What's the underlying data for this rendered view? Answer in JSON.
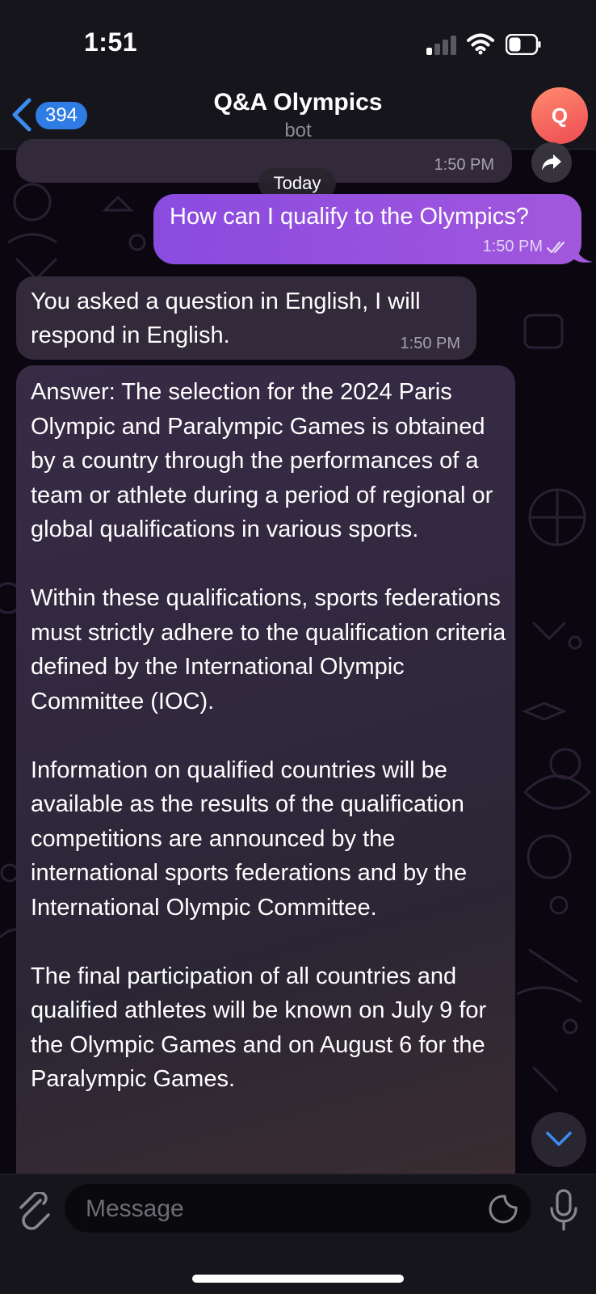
{
  "status_bar": {
    "time": "1:51"
  },
  "header": {
    "back_count": "394",
    "title": "Q&A Olympics",
    "subtitle": "bot",
    "avatar_letter": "Q",
    "avatar_color": "#f25a57"
  },
  "messages": {
    "previous_time": "1:50 PM",
    "day_separator": "Today",
    "outgoing": {
      "text": "How can I qualify to the Olympics?",
      "time": "1:50 PM",
      "status": "read"
    },
    "incoming_1": {
      "text": "You asked a question in English, I will respond in English.",
      "time": "1:50 PM"
    },
    "incoming_2": {
      "text": "Answer: The selection for the 2024 Paris Olympic and Paralympic Games is obtained by a country through the performances of a team or athlete during a period of regional or global qualifications in various sports.\n\nWithin these qualifications, sports federations must strictly adhere to the qualification criteria defined by the International Olympic Committee (IOC).\n\nInformation on qualified countries will be available as the results of the qualification competitions are announced by the international sports federations and by the International Olympic Committee.\n\nThe final participation of all countries and qualified athletes will be known on July 9 for the Olympic Games and on August 6 for the Paralympic Games."
    }
  },
  "composer": {
    "placeholder": "Message"
  },
  "icons": [
    "back-chevron-icon",
    "share-icon",
    "double-check-icon",
    "scroll-down-icon",
    "paperclip-icon",
    "sticker-icon",
    "microphone-icon",
    "signal-icon",
    "wifi-icon",
    "battery-icon"
  ],
  "colors": {
    "accent": "#2f7de4",
    "outgoing_bubble": "#9350df",
    "scroll_arrow": "#3b8cf0"
  }
}
